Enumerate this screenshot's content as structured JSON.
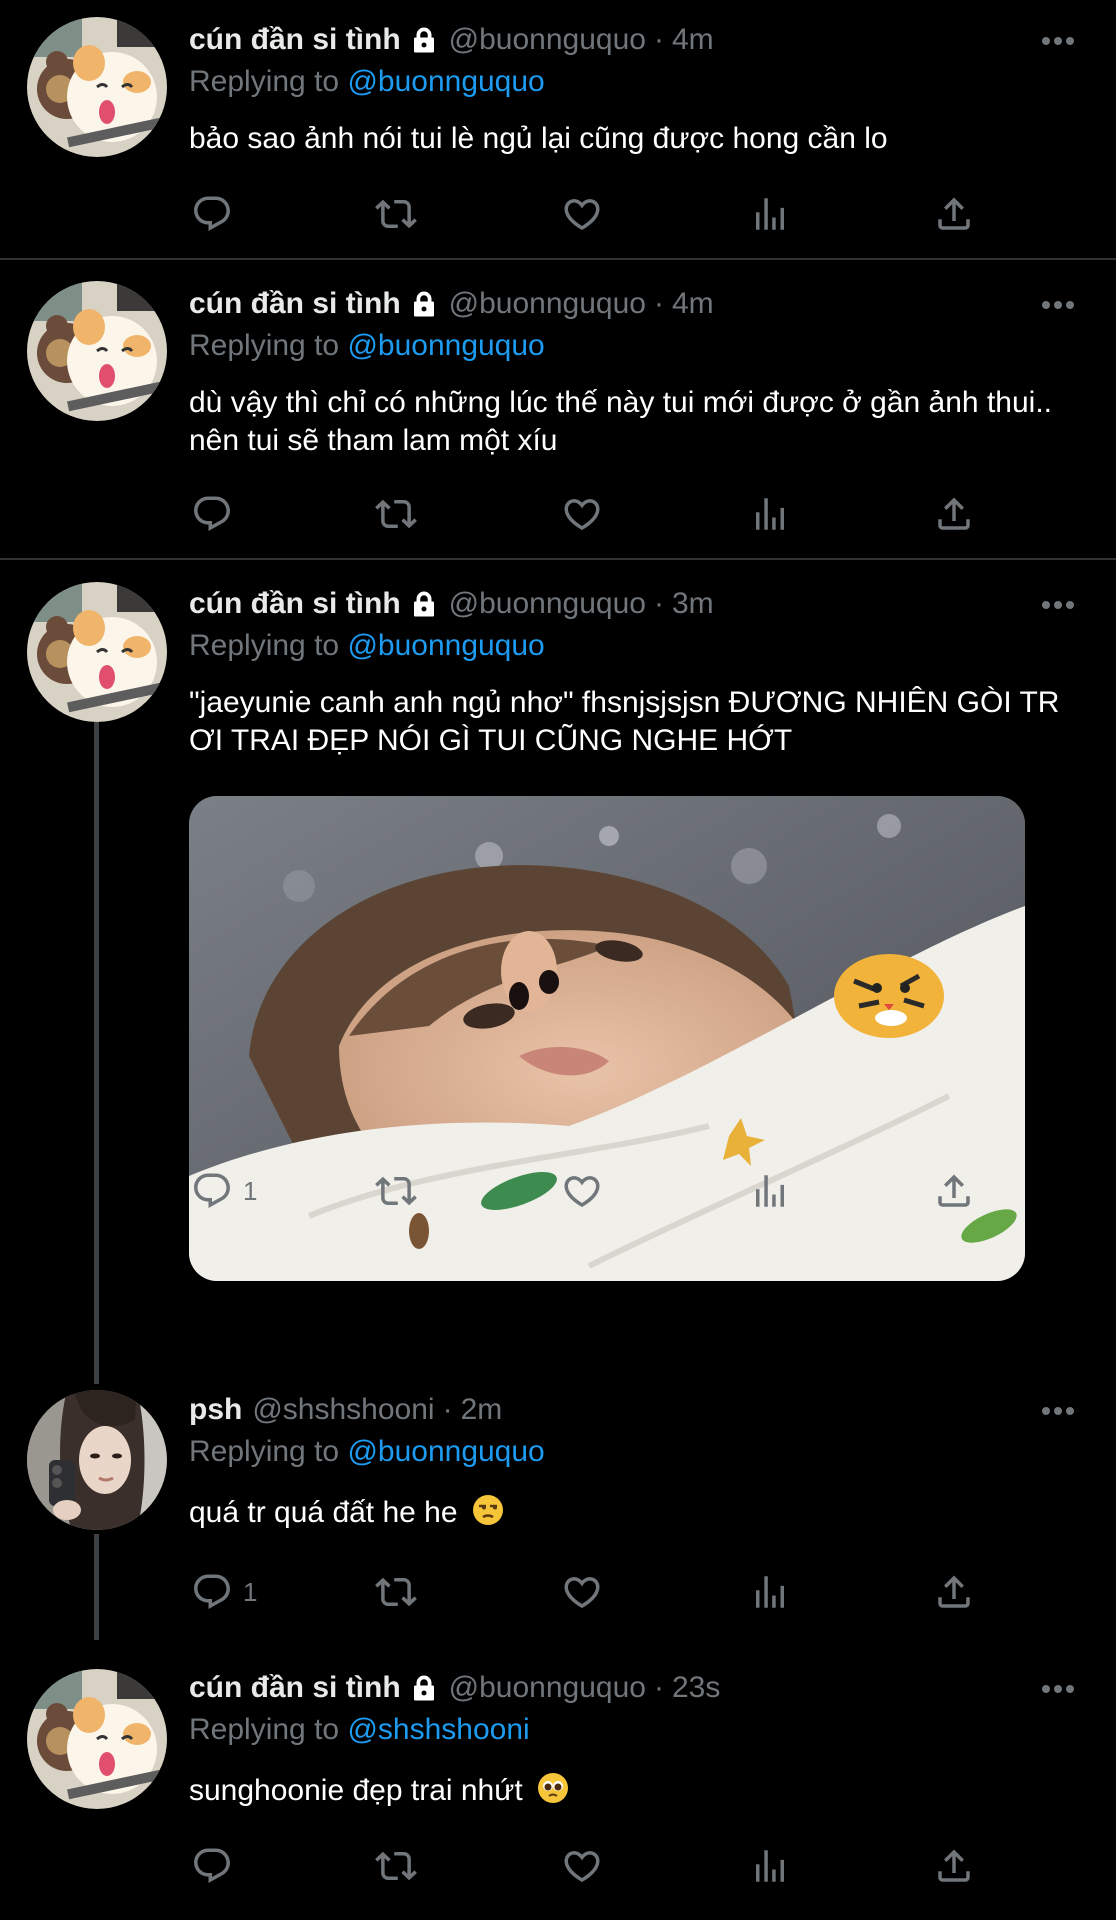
{
  "tweets": [
    {
      "name": "cún đần si tình",
      "locked": true,
      "handle": "@buonnguquo",
      "time": "4m",
      "replying_prefix": "Replying to",
      "replying_to": "@buonnguquo",
      "text": "bảo sao ảnh nói tui lè ngủ lại cũng được hong cần lo",
      "reply_count": ""
    },
    {
      "name": "cún đần si tình",
      "locked": true,
      "handle": "@buonnguquo",
      "time": "4m",
      "replying_prefix": "Replying to",
      "replying_to": "@buonnguquo",
      "text": "dù vậy thì chỉ có những lúc thế này tui mới được ở gần ảnh thui.. nên tui sẽ tham lam một xíu",
      "reply_count": ""
    },
    {
      "name": "cún đần si tình",
      "locked": true,
      "handle": "@buonnguquo",
      "time": "3m",
      "replying_prefix": "Replying to",
      "replying_to": "@buonnguquo",
      "text": "\"jaeyunie canh anh ngủ nhơ\" fhsnjsjsjsn ĐƯƠNG NHIÊN GÒI TR ƠI TRAI ĐẸP NÓI GÌ TUI CŨNG NGHE HỚT",
      "has_media": true,
      "reply_count": "1"
    },
    {
      "name": "psh",
      "locked": false,
      "handle": "@shshshooni",
      "time": "2m",
      "replying_prefix": "Replying to",
      "replying_to": "@buonnguquo",
      "text": "quá tr quá đất he he",
      "emoji": "unamused-face",
      "reply_count": "1"
    },
    {
      "name": "cún đần si tình",
      "locked": true,
      "handle": "@buonnguquo",
      "time": "23s",
      "replying_prefix": "Replying to",
      "replying_to": "@shshshooni",
      "text": "sunghoonie đẹp trai nhứt",
      "emoji": "pleading-face",
      "reply_count": ""
    }
  ],
  "icons": {
    "reply": "reply-icon",
    "retweet": "retweet-icon",
    "like": "like-icon",
    "views": "views-icon",
    "share": "share-icon",
    "more": "more-icon",
    "lock": "lock-icon"
  },
  "colors": {
    "background": "#000000",
    "text": "#ffffff",
    "secondary": "#71767b",
    "accent": "#1d9bf0",
    "divider": "#2f3336"
  }
}
